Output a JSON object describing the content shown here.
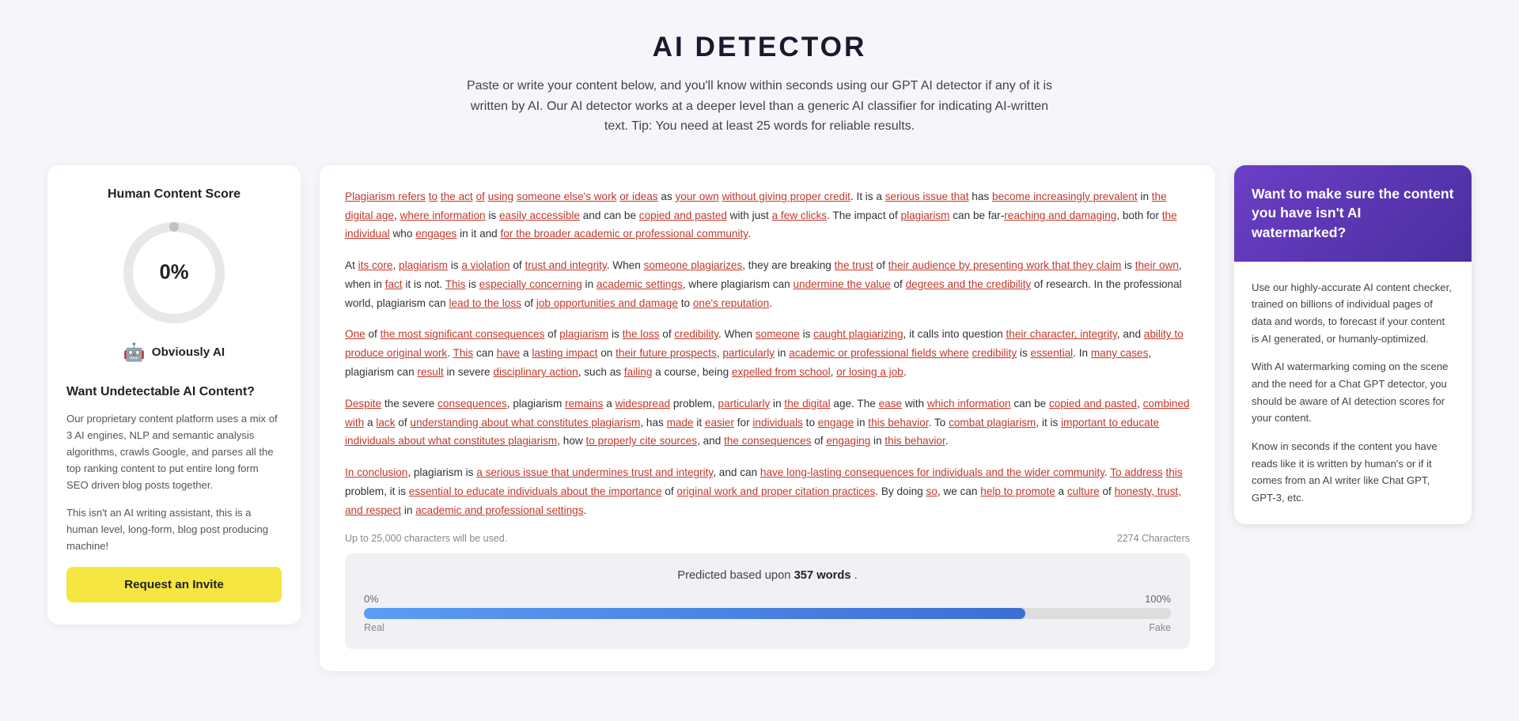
{
  "header": {
    "title": "AI DETECTOR",
    "description": "Paste or write your content below, and you'll know within seconds using our GPT AI detector if any of it is written by AI. Our AI detector works at a deeper level than a generic AI classifier for indicating AI-written text. Tip: You need at least 25 words for reliable results."
  },
  "left_panel": {
    "section_title": "Human Content Score",
    "score_value": "0%",
    "score_label": "Obviously AI",
    "want_title": "Want Undetectable AI Content?",
    "description1": "Our proprietary content platform uses a mix of 3 AI engines, NLP and semantic analysis algorithms, crawls Google, and parses all the top ranking content to put entire long form SEO driven blog posts together.",
    "description2": "This isn't an AI writing assistant, this is a human level, long-form, blog post producing machine!",
    "button_label": "Request an Invite"
  },
  "center_panel": {
    "paragraphs": [
      "Plagiarism refers to the act of using someone else's work or ideas as your own without giving proper credit. It is a serious issue that has become increasingly prevalent in the digital age, where information is easily accessible and can be copied and pasted with just a few clicks. The impact of plagiarism can be far-reaching and damaging, both for the individual who engages in it and for the broader academic or professional community.",
      "At its core, plagiarism is a violation of trust and integrity. When someone plagiarizes, they are breaking the trust of their audience by presenting work that they claim is their own, when in fact it is not. This is especially concerning in academic settings, where plagiarism can undermine the value of degrees and the credibility of research. In the professional world, plagiarism can lead to the loss of job opportunities and damage to one's reputation.",
      "One of the most significant consequences of plagiarism is the loss of credibility. When someone is caught plagiarizing, it calls into question their character, integrity, and ability to produce original work. This can have a lasting impact on their future prospects, particularly in academic or professional fields where credibility is essential. In many cases, plagiarism can result in severe disciplinary action, such as failing a course, being expelled from school, or losing a job.",
      "Despite the severe consequences, plagiarism remains a widespread problem, particularly in the digital age. The ease with which information can be copied and pasted, combined with a lack of understanding about what constitutes plagiarism, has made it easier for individuals to engage in this behavior. To combat plagiarism, it is important to educate individuals about what constitutes plagiarism, how to properly cite sources, and the consequences of engaging in this behavior.",
      "In conclusion, plagiarism is a serious issue that undermines trust and integrity, and can have long-lasting consequences for individuals and the wider community. To address this problem, it is essential to educate individuals about the importance of original work and proper citation practices. By doing so, we can help to promote a culture of honesty, trust, and respect in academic and professional settings."
    ],
    "char_limit_note": "Up to 25,000 characters will be used.",
    "char_count": "2274 Characters",
    "prediction_label": "Predicted based upon",
    "prediction_words": "357 words",
    "prediction_suffix": ".",
    "bar_left_pct": "0%",
    "bar_left_label": "Real",
    "bar_right_pct": "100%",
    "bar_right_label": "Fake"
  },
  "right_panel": {
    "top_title": "Want to make sure the content you have isn't AI watermarked?",
    "para1": "Use our highly-accurate AI content checker, trained on billions of individual pages of data and words, to forecast if your content is AI generated, or humanly-optimized.",
    "para2": "With AI watermarking coming on the scene and the need for a Chat GPT detector, you should be aware of AI detection scores for your content.",
    "para3": "Know in seconds if the content you have reads like it is written by human's or if it comes from an AI writer like Chat GPT, GPT-3, etc."
  }
}
